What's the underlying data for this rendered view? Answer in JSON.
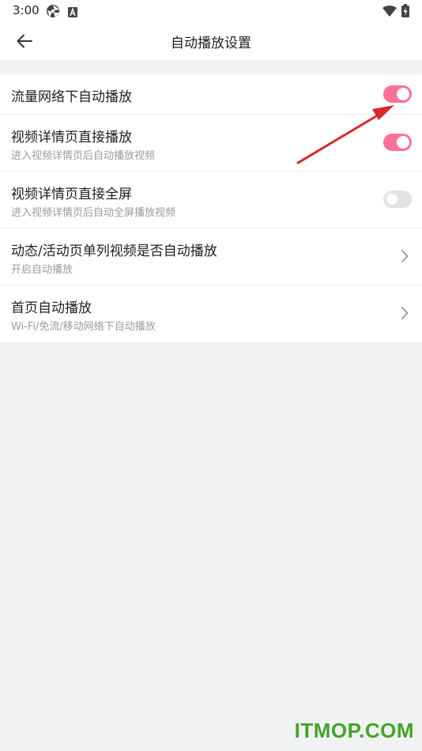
{
  "status_bar": {
    "time": "3:00"
  },
  "header": {
    "title": "自动播放设置"
  },
  "settings": {
    "items": [
      {
        "title": "流量网络下自动播放",
        "subtitle": "",
        "control": "toggle",
        "on": true
      },
      {
        "title": "视频详情页直接播放",
        "subtitle": "进入视频详情页后自动播放视频",
        "control": "toggle",
        "on": true
      },
      {
        "title": "视频详情页直接全屏",
        "subtitle": "进入视频详情页后自动全屏播放视频",
        "control": "toggle",
        "on": false
      },
      {
        "title": "动态/活动页单列视频是否自动播放",
        "subtitle": "开启自动播放",
        "control": "chevron"
      },
      {
        "title": "首页自动播放",
        "subtitle": "Wi-Fi/免流/移动网络下自动播放",
        "control": "chevron"
      }
    ]
  },
  "colors": {
    "accent": "#fb7299",
    "annotation_arrow": "#d42a2a",
    "watermark": "#43a528"
  },
  "watermark": {
    "text": "ITMOP.COM"
  }
}
